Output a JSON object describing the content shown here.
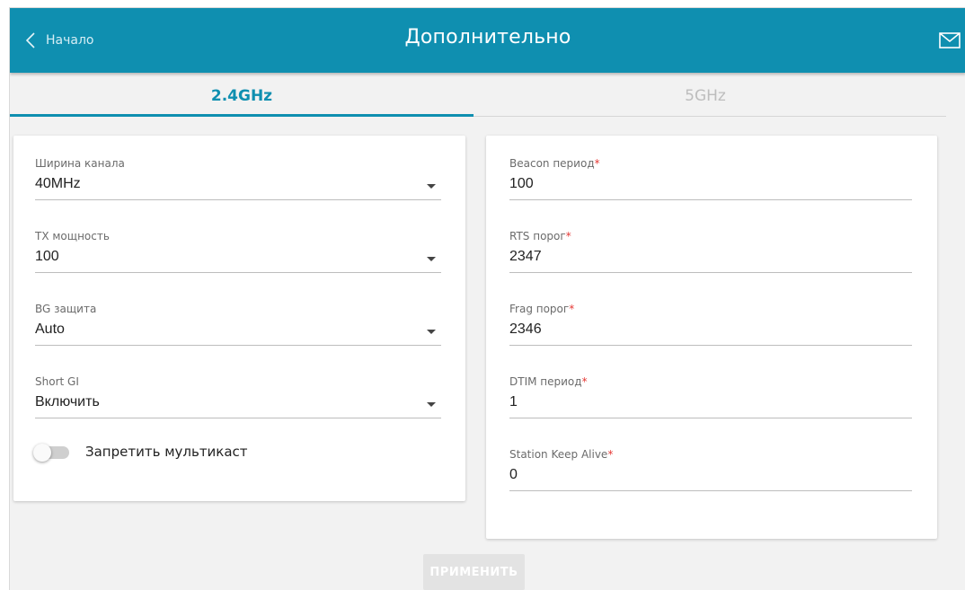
{
  "header": {
    "back_label": "Начало",
    "title": "Дополнительно",
    "accent_color": "#0f8fb0"
  },
  "tabs": [
    {
      "label": "2.4GHz",
      "active": true
    },
    {
      "label": "5GHz",
      "active": false
    }
  ],
  "left_card": {
    "fields": [
      {
        "label": "Ширина канала",
        "value": "40MHz",
        "type": "select"
      },
      {
        "label": "TX мощность",
        "value": "100",
        "type": "select"
      },
      {
        "label": "BG защита",
        "value": "Auto",
        "type": "select"
      },
      {
        "label": "Short GI",
        "value": "Включить",
        "type": "select"
      }
    ],
    "toggle": {
      "label": "Запретить мультикаст",
      "on": false
    }
  },
  "right_card": {
    "fields": [
      {
        "label": "Beacon период",
        "required_mark": "*",
        "value": "100"
      },
      {
        "label": "RTS порог",
        "required_mark": "*",
        "value": "2347"
      },
      {
        "label": "Frag порог",
        "required_mark": "*",
        "value": "2346"
      },
      {
        "label": "DTIM период",
        "required_mark": "*",
        "value": "1"
      },
      {
        "label": "Station Keep Alive",
        "required_mark": "*",
        "value": "0"
      }
    ]
  },
  "apply_button": {
    "label": "ПРИМЕНИТЬ",
    "enabled": false
  },
  "icons": {
    "back": "chevron-left-icon",
    "mail": "envelope-icon"
  }
}
